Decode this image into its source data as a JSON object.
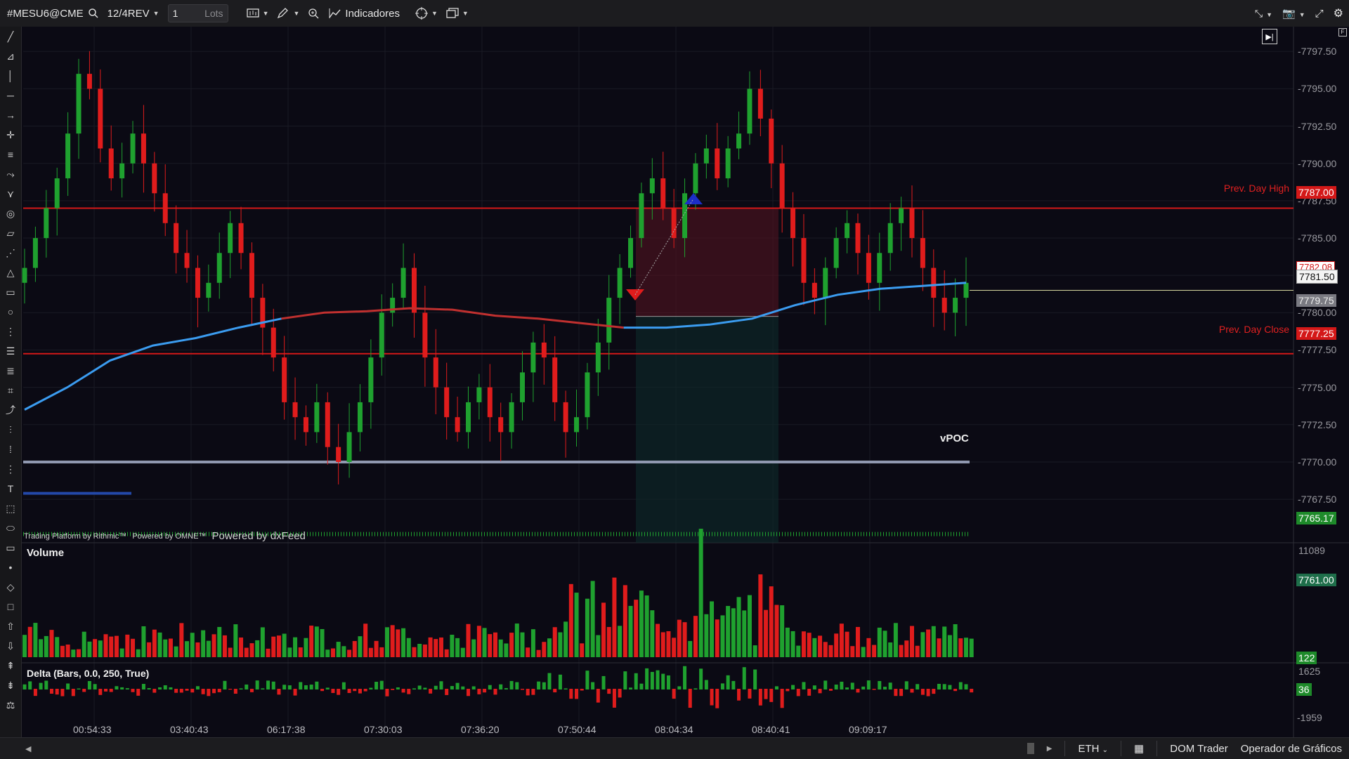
{
  "toolbar": {
    "symbol": "#MESU6@CME",
    "period": "12/4REV",
    "quantity": "1",
    "quantity_unit": "Lots",
    "indicators_label": "Indicadores"
  },
  "left_tools": [
    "line-icon",
    "angle-icon",
    "vertical-line-icon",
    "horizontal-line-icon",
    "arrow-line-icon",
    "cross-icon",
    "lines-icon",
    "curve-icon",
    "pitchfork-icon",
    "target-icon",
    "ruler-icon",
    "fib-icon",
    "triangle-icon",
    "rectangle-icon",
    "ellipse-icon",
    "fib-fan-icon",
    "fib-levels-icon",
    "fib-ext-icon",
    "gann-icon",
    "regression-icon",
    "bars-icon",
    "select-icon",
    "dots-icon",
    "text-icon",
    "tag-icon",
    "callout-icon",
    "note-icon",
    "dot-icon",
    "diamond-icon",
    "square-icon",
    "arrow-up-icon",
    "arrow-down-icon",
    "sort-asc-icon",
    "sort-desc-icon",
    "scale-icon"
  ],
  "price_panel": {
    "axis_ticks": [
      "7797.50",
      "7795.00",
      "7792.50",
      "7790.00",
      "7787.50",
      "7785.00",
      "7782.50",
      "7780.00",
      "7777.50",
      "7775.00",
      "7772.50",
      "7770.00",
      "7767.50"
    ],
    "prev_day_high": {
      "label": "Prev. Day High",
      "value": "7787.00"
    },
    "prev_day_close": {
      "label": "Prev. Day Close",
      "value": "7777.25"
    },
    "tags": {
      "red_upper": "7782.08",
      "last": "7781.50",
      "gray": "7779.75",
      "green": "7765.17"
    },
    "vpoc_label": "vPOC",
    "watermark": {
      "rithmic": "Trading Platform by Rithmic™",
      "omne": "Powered by OMNE™",
      "dxfeed": "Powered by dxFeed"
    }
  },
  "volume_panel": {
    "title": "Volume",
    "max_label": "11089",
    "tag_price": "7761.00",
    "tag_current": "122"
  },
  "delta_panel": {
    "title": "Delta (Bars, 0.0, 250, True)",
    "top_label": "1625",
    "bottom_label": "-1959",
    "tag_current": "36"
  },
  "x_axis": [
    "00:54:33",
    "03:40:43",
    "06:17:38",
    "07:30:03",
    "07:36:20",
    "07:50:44",
    "08:04:34",
    "08:40:41",
    "09:09:17"
  ],
  "bottom_bar": {
    "session": "ETH",
    "dom_trader": "DOM Trader",
    "chart_trader": "Operador de Gráficos"
  },
  "colors": {
    "up": "#1fa12f",
    "down": "#e01c1c",
    "vwap": "#3b9cf0",
    "vwap_below": "#c0302f",
    "reference": "#d41818",
    "vpoc": "#9098b0",
    "background": "#0b0a14"
  },
  "chart_data": {
    "type": "candlestick",
    "ylim": [
      7766.0,
      7798.5
    ],
    "reference_lines": [
      {
        "name": "Prev. Day High",
        "y": 7787.0
      },
      {
        "name": "Prev. Day Close",
        "y": 7777.25
      }
    ],
    "vpoc": 7770.0,
    "last_price": 7781.5,
    "price_path": [
      7783,
      7785,
      7787,
      7789,
      7792,
      7796,
      7795,
      7791,
      7789,
      7790,
      7792,
      7790,
      7788,
      7786,
      7784,
      7783,
      7781,
      7782,
      7784,
      7786,
      7784,
      7781,
      7779,
      7777,
      7774,
      7773,
      7772,
      7774,
      7771,
      7770,
      7772,
      7774,
      7777,
      7780,
      7781,
      7783,
      7780,
      7777,
      7775,
      7773,
      7772,
      7774,
      7775,
      7773,
      7772,
      7774,
      7776,
      7778,
      7777,
      7774,
      7772,
      7773,
      7776,
      7778,
      7781,
      7783,
      7785,
      7788,
      7789,
      7787,
      7785,
      7788,
      7790,
      7791,
      7789,
      7791,
      7792,
      7795,
      7793,
      7790,
      7787,
      7785,
      7782,
      7781,
      7783,
      7785,
      7786,
      7784,
      7782,
      7784,
      7786,
      7787,
      7785,
      7783,
      7781,
      7780,
      7781,
      7782
    ],
    "vwap_series": [
      7773.5,
      7775.0,
      7776.8,
      7777.8,
      7778.3,
      7779.0,
      7779.6,
      7780.0,
      7780.1,
      7780.3,
      7780.2,
      7779.8,
      7779.6,
      7779.3,
      7779.0,
      7779.0,
      7779.2,
      7779.6,
      7780.5,
      7781.2,
      7781.6,
      7781.8,
      7782.0
    ],
    "volume_max": 11089,
    "delta_range": [
      -1959,
      1625
    ]
  }
}
